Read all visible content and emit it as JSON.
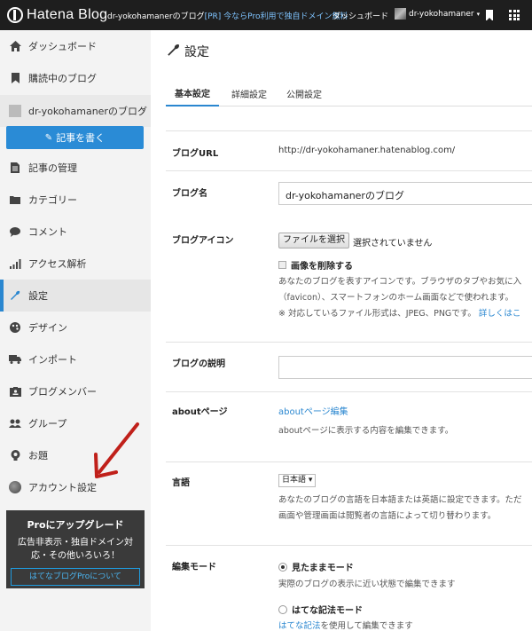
{
  "topbar": {
    "logo_text": "Hatena Blog",
    "blog_name": "dr-yokohamanerのブログ",
    "promo": "[PR] 今ならPro利用で独自ドメイン無料",
    "dashboard": "ダッシュボード",
    "user": "dr-yokohamaner",
    "caret": "▾"
  },
  "sidebar": {
    "items": [
      {
        "label": "ダッシュボード",
        "icon": "home-icon"
      },
      {
        "label": "購読中のブログ",
        "icon": "bookmark-icon"
      },
      {
        "label": "dr-yokohamanerのブログ",
        "icon": "blog-thumbnail"
      },
      {
        "label": "記事の管理",
        "icon": "document-icon"
      },
      {
        "label": "カテゴリー",
        "icon": "folder-icon"
      },
      {
        "label": "コメント",
        "icon": "comment-icon"
      },
      {
        "label": "アクセス解析",
        "icon": "bar-chart-icon"
      },
      {
        "label": "設定",
        "icon": "wrench-icon"
      },
      {
        "label": "デザイン",
        "icon": "palette-icon"
      },
      {
        "label": "インポート",
        "icon": "truck-icon"
      },
      {
        "label": "ブログメンバー",
        "icon": "id-card-icon"
      },
      {
        "label": "グループ",
        "icon": "users-icon"
      },
      {
        "label": "お題",
        "icon": "bulb-icon"
      },
      {
        "label": "アカウント設定",
        "icon": "avatar"
      }
    ],
    "write_button": "記事を書く",
    "chevron": "›",
    "pro": {
      "title": "Proにアップグレード",
      "desc_line1": "広告非表示・独自ドメイン対",
      "desc_line2": "応・その他いろいろ！",
      "button": "はてなブログProについて"
    }
  },
  "main": {
    "title": "設定",
    "tabs": [
      "基本設定",
      "詳細設定",
      "公開設定"
    ],
    "fields": {
      "url_label": "ブログURL",
      "url_value": "http://dr-yokohamaner.hatenablog.com/",
      "name_label": "ブログ名",
      "name_value": "dr-yokohamanerのブログ",
      "icon_label": "ブログアイコン",
      "file_button": "ファイルを選択",
      "file_none": "選択されていません",
      "delete_image": "画像を削除する",
      "icon_help1": "あなたのブログを表すアイコンです。ブラウザのタブやお気に入",
      "icon_help2": "（favicon）、スマートフォンのホーム画面などで使われます。",
      "icon_help3": "※ 対応しているファイル形式は、JPEG、PNGです。",
      "icon_help_link": "詳しくはこ",
      "desc_label": "ブログの説明",
      "about_label": "aboutページ",
      "about_link": "aboutページ編集",
      "about_help": "aboutページに表示する内容を編集できます。",
      "lang_label": "言語",
      "lang_value": "日本語",
      "lang_help1": "あなたのブログの言語を日本語または英語に設定できます。ただ",
      "lang_help2": "画面や管理画面は閲覧者の言語によって切り替わります。",
      "edit_label": "編集モード",
      "mode_wysiwyg": "見たままモード",
      "mode_wysiwyg_help": "実際のブログの表示に近い状態で編集できます",
      "mode_hatena": "はてな記法モード",
      "mode_hatena_link": "はてな記法",
      "mode_hatena_help": "を使用して編集できます"
    }
  },
  "colors": {
    "accent": "#2a87d0",
    "topbar": "#1e1e1e",
    "annotation_arrow": "#c0201a"
  }
}
